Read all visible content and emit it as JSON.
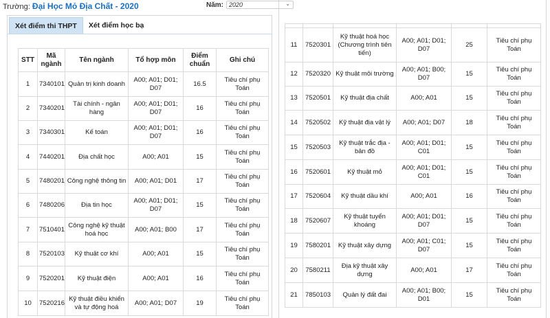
{
  "header": {
    "school_label": "Trường:",
    "school_name": "Đại Học Mỏ Địa Chất - 2020",
    "year_label": "Năm:",
    "year_value": "2020"
  },
  "tabs": [
    {
      "label": "Xét điểm thi THPT",
      "active": true
    },
    {
      "label": "Xét điểm học bạ",
      "active": false
    }
  ],
  "table": {
    "columns": [
      "STT",
      "Mã ngành",
      "Tên ngành",
      "Tổ hợp môn",
      "Điểm chuẩn",
      "Ghi chú"
    ],
    "left_rows": [
      {
        "stt": "1",
        "code": "7340101",
        "name": "Quản trị kinh doanh",
        "combo": "A00; A01; D01; D07",
        "score": "16.5",
        "note": "Tiêu chí phụ Toán"
      },
      {
        "stt": "2",
        "code": "7340201",
        "name": "Tài chính - ngân hàng",
        "combo": "A00; A01; D01; D07",
        "score": "16",
        "note": "Tiêu chí phụ Toán"
      },
      {
        "stt": "3",
        "code": "7340301",
        "name": "Kế toán",
        "combo": "A00; A01; D01; D07",
        "score": "16",
        "note": "Tiêu chí phụ Toán"
      },
      {
        "stt": "4",
        "code": "7440201",
        "name": "Địa chất học",
        "combo": "A00; A01",
        "score": "15",
        "note": "Tiêu chí phụ Toán"
      },
      {
        "stt": "5",
        "code": "7480201",
        "name": "Công nghệ thông tin",
        "combo": "A00; A01; D01",
        "score": "17",
        "note": "Tiêu chí phụ Toán"
      },
      {
        "stt": "6",
        "code": "7480206",
        "name": "Địa tin học",
        "combo": "A00; A01; D01; D07",
        "score": "15",
        "note": "Tiêu chí phụ Toán"
      },
      {
        "stt": "7",
        "code": "7510401",
        "name": "Công nghệ kỹ thuật hoá học",
        "combo": "A00; A01; B00",
        "score": "17",
        "note": "Tiêu chí phụ Toán"
      },
      {
        "stt": "8",
        "code": "7520103",
        "name": "Kỹ thuật cơ khí",
        "combo": "A00; A01",
        "score": "15",
        "note": "Tiêu chí phụ Toán"
      },
      {
        "stt": "9",
        "code": "7520201",
        "name": "Kỹ thuật điện",
        "combo": "A00; A01",
        "score": "16",
        "note": "Tiêu chí phụ Toán"
      },
      {
        "stt": "10",
        "code": "7520216",
        "name": "Kỹ thuật điều khiển và tự động hoá",
        "combo": "A00; A01; D07",
        "score": "19",
        "note": "Tiêu chí phụ Toán"
      }
    ],
    "right_rows": [
      {
        "stt": "11",
        "code": "7520301",
        "name": "Kỹ thuật hoá học (Chương trình tiên tiến)",
        "combo": "A00; A01; D01; D07",
        "score": "25",
        "note": "Tiêu chí phụ Toán"
      },
      {
        "stt": "12",
        "code": "7520320",
        "name": "Kỹ thuật môi trường",
        "combo": "A00; A01; B00; D07",
        "score": "15",
        "note": "Tiêu chí phụ Toán"
      },
      {
        "stt": "13",
        "code": "7520501",
        "name": "Kỹ thuật địa chất",
        "combo": "A00; A01",
        "score": "15",
        "note": "Tiêu chí phụ Toán"
      },
      {
        "stt": "14",
        "code": "7520502",
        "name": "Kỹ thuật địa vật lý",
        "combo": "A00; A01; D07",
        "score": "18",
        "note": "Tiêu chí phụ Toán"
      },
      {
        "stt": "15",
        "code": "7520503",
        "name": "Kỹ thuật trắc địa - bản đồ",
        "combo": "A00; A01; D01; C01",
        "score": "15",
        "note": "Tiêu chí phụ Toán"
      },
      {
        "stt": "16",
        "code": "7520601",
        "name": "Kỹ thuật mỏ",
        "combo": "A00; A01; D01; C01",
        "score": "15",
        "note": "Tiêu chí phụ Toán"
      },
      {
        "stt": "17",
        "code": "7520604",
        "name": "Kỹ thuật dầu khí",
        "combo": "A00; A01",
        "score": "16",
        "note": "Tiêu chí phụ Toán"
      },
      {
        "stt": "18",
        "code": "7520607",
        "name": "Kỹ thuật tuyển khoáng",
        "combo": "A00; A01; D01; D07",
        "score": "15",
        "note": "Tiêu chí phụ Toán"
      },
      {
        "stt": "19",
        "code": "7580201",
        "name": "Kỹ thuật xây dựng",
        "combo": "A00; A01; C01; D07",
        "score": "15",
        "note": "Tiêu chí phụ Toán"
      },
      {
        "stt": "20",
        "code": "7580211",
        "name": "Địa kỹ thuật xây dựng",
        "combo": "A00; A01",
        "score": "17",
        "note": "Tiêu chí phụ Toán"
      },
      {
        "stt": "21",
        "code": "7850103",
        "name": "Quản lý đất đai",
        "combo": "A00; A01; B00; D01",
        "score": "15",
        "note": "Tiêu chí phụ Toán"
      }
    ]
  }
}
